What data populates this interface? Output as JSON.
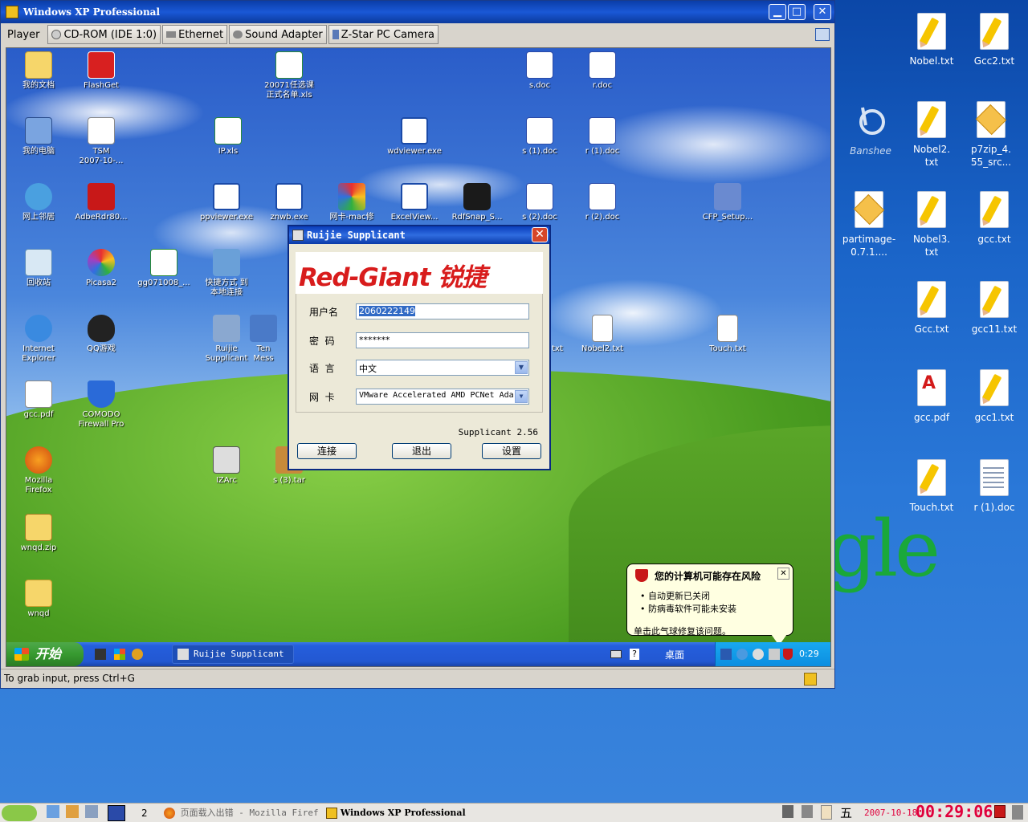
{
  "vm_window": {
    "title": "Windows XP Professional",
    "controls": {
      "minimize": "▁",
      "maximize": "□",
      "close": "✕"
    },
    "toolbar": {
      "player": "Player",
      "cdrom": "CD-ROM (IDE 1:0)",
      "ethernet": "Ethernet",
      "sound": "Sound Adapter",
      "camera": "Z-Star PC Camera"
    },
    "status": "To grab input, press Ctrl+G"
  },
  "guest_desktop": {
    "icons": [
      {
        "label": "我的文档",
        "icon": "folder-icon"
      },
      {
        "label": "FlashGet",
        "icon": "flashget-icon"
      },
      {
        "label": "20071任选课\n正式名单.xls",
        "icon": "excel-icon"
      },
      {
        "label": "s.doc",
        "icon": "word-icon"
      },
      {
        "label": "r.doc",
        "icon": "word-icon"
      },
      {
        "label": "我的电脑",
        "icon": "computer-icon"
      },
      {
        "label": "TSM\n2007-10-...",
        "icon": "tsm-icon"
      },
      {
        "label": "IP.xls",
        "icon": "excel-icon"
      },
      {
        "label": "wdviewer.exe",
        "icon": "window-icon"
      },
      {
        "label": "s (1).doc",
        "icon": "word-icon"
      },
      {
        "label": "r (1).doc",
        "icon": "word-icon"
      },
      {
        "label": "网上邻居",
        "icon": "network-icon"
      },
      {
        "label": "AdbeRdr80...",
        "icon": "acrobat-icon"
      },
      {
        "label": "ppviewer.exe",
        "icon": "window-icon"
      },
      {
        "label": "znwb.exe",
        "icon": "window-icon"
      },
      {
        "label": "网卡-mac修",
        "icon": "cube-icon"
      },
      {
        "label": "ExcelView...",
        "icon": "window-icon"
      },
      {
        "label": "RdfSnap_S...",
        "icon": "camera-icon"
      },
      {
        "label": "s (2).doc",
        "icon": "word-icon"
      },
      {
        "label": "r (2).doc",
        "icon": "word-icon"
      },
      {
        "label": "CFP_Setup...",
        "icon": "setup-icon"
      },
      {
        "label": "回收站",
        "icon": "recycle-bin-icon"
      },
      {
        "label": "Picasa2",
        "icon": "picasa-icon"
      },
      {
        "label": "gg071008_...",
        "icon": "excel-icon"
      },
      {
        "label": "快捷方式 到\n本地连接",
        "icon": "network-shortcut-icon"
      },
      {
        "label": "Internet\nExplorer",
        "icon": "ie-icon"
      },
      {
        "label": "QQ游戏",
        "icon": "qq-icon"
      },
      {
        "label": "Ruijie\nSupplicant",
        "icon": "ruijie-icon"
      },
      {
        "label": "Ten\nMess",
        "icon": "app-icon"
      },
      {
        "label": "txt",
        "icon": "text-icon"
      },
      {
        "label": "Nobel2.txt",
        "icon": "notepad-icon"
      },
      {
        "label": "Touch.txt",
        "icon": "notepad-icon"
      },
      {
        "label": "gcc.pdf",
        "icon": "pdf-icon"
      },
      {
        "label": "COMODO\nFirewall Pro",
        "icon": "shield-icon"
      },
      {
        "label": "Mozilla\nFirefox",
        "icon": "firefox-icon"
      },
      {
        "label": "IZArc",
        "icon": "izarc-icon"
      },
      {
        "label": "s (3).tar",
        "icon": "archive-icon"
      },
      {
        "label": "wnqd.zip",
        "icon": "zip-icon"
      },
      {
        "label": "wnqd",
        "icon": "folder-icon"
      }
    ],
    "taskbar": {
      "start_label": "开始",
      "task_label": "Ruijie Supplicant",
      "desktop_label": "桌面",
      "time": "0:29"
    },
    "balloon": {
      "title": "您的计算机可能存在风险",
      "items": [
        "自动更新已关闭",
        "防病毒软件可能未安装"
      ],
      "footer": "单击此气球修复该问题。",
      "close": "✕"
    }
  },
  "dialog": {
    "title": "Ruijie Supplicant",
    "close": "✕",
    "logo_text": "Red-Giant 锐捷",
    "username_label": "用户名",
    "username_value": "2060222149",
    "password_label": "密  码",
    "password_value": "*******",
    "language_label": "语  言",
    "language_value": "中文",
    "nic_label": "网  卡",
    "nic_value": "VMware Accelerated AMD PCNet Ada",
    "version": "Supplicant 2.56",
    "connect_button": "连接",
    "exit_button": "退出",
    "settings_button": "设置"
  },
  "host_desktop": {
    "icons": [
      {
        "label": "Nobel.txt",
        "icon": "text-file-icon"
      },
      {
        "label": "Gcc2.txt",
        "icon": "text-file-icon"
      },
      {
        "label": "Banshee",
        "icon": "banshee-icon"
      },
      {
        "label": "Nobel2.\ntxt",
        "icon": "text-file-icon"
      },
      {
        "label": "p7zip_4.\n55_src...",
        "icon": "package-icon"
      },
      {
        "label": "partimage-\n0.7.1....",
        "icon": "package-icon"
      },
      {
        "label": "Nobel3.\ntxt",
        "icon": "text-file-icon"
      },
      {
        "label": "gcc.txt",
        "icon": "text-file-icon"
      },
      {
        "label": "Gcc.txt",
        "icon": "text-file-icon"
      },
      {
        "label": "gcc11.txt",
        "icon": "text-file-icon"
      },
      {
        "label": "gcc.pdf",
        "icon": "pdf-file-icon"
      },
      {
        "label": "gcc1.txt",
        "icon": "text-file-icon"
      },
      {
        "label": "Touch.txt",
        "icon": "text-file-icon"
      },
      {
        "label": "r (1).doc",
        "icon": "doc-file-icon"
      }
    ],
    "wallpaper_text": "gle",
    "taskbar": {
      "workspace": "2",
      "firefox_task": "页面载入出错 - Mozilla Firef",
      "vm_task": "Windows XP Professional",
      "input_method": "五",
      "date": "2007-10-18",
      "clock": "00:29:06"
    }
  }
}
